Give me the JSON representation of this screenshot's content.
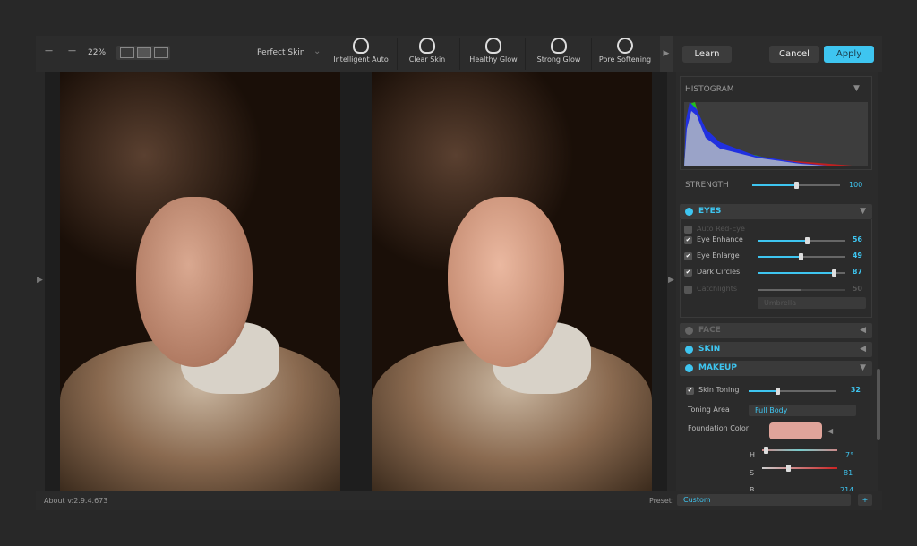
{
  "toolbar": {
    "zoom": "22%",
    "preset_menu": "Perfect Skin",
    "tools": [
      {
        "label": "Intelligent Auto",
        "icon": "intelligent-auto-icon"
      },
      {
        "label": "Clear Skin",
        "icon": "clear-skin-icon"
      },
      {
        "label": "Healthy Glow",
        "icon": "healthy-glow-icon"
      },
      {
        "label": "Strong Glow",
        "icon": "strong-glow-icon"
      },
      {
        "label": "Pore Softening",
        "icon": "pore-softening-icon"
      }
    ],
    "auto_badge": "AUTO"
  },
  "buttons": {
    "learn": "Learn",
    "cancel": "Cancel",
    "apply": "Apply"
  },
  "colors": {
    "accent": "#3ec5f0",
    "foundation": "#e0a49a"
  },
  "histogram": {
    "title": "HISTOGRAM"
  },
  "strength": {
    "label": "STRENGTH",
    "value": "100",
    "level": 50
  },
  "eyes": {
    "title": "EYES",
    "auto_red_eye": "Auto Red-Eye",
    "sliders": [
      {
        "label": "Eye Enhance",
        "value": "56",
        "checked": true,
        "level": 56
      },
      {
        "label": "Eye Enlarge",
        "value": "49",
        "checked": true,
        "level": 49
      },
      {
        "label": "Dark Circles",
        "value": "87",
        "checked": true,
        "level": 87
      },
      {
        "label": "Catchlights",
        "value": "50",
        "checked": false,
        "level": 50
      }
    ],
    "catchlight_shape": "Umbrella"
  },
  "face": {
    "title": "FACE"
  },
  "skin": {
    "title": "SKIN"
  },
  "makeup": {
    "title": "MAKEUP",
    "skin_toning": {
      "label": "Skin Toning",
      "value": "32",
      "level": 32
    },
    "toning_area_label": "Toning Area",
    "toning_area": "Full Body",
    "foundation_label": "Foundation Color",
    "h": {
      "label": "H",
      "value": "7°"
    },
    "s": {
      "label": "S",
      "value": "81"
    },
    "b": {
      "label": "B",
      "value": "214"
    }
  },
  "status": {
    "about": "About v:2.9.4.673",
    "preset_label": "Preset:",
    "preset_value": "Custom",
    "add": "+"
  }
}
